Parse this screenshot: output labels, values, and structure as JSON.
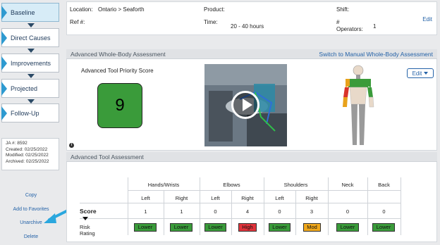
{
  "sidebar": {
    "steps": [
      {
        "label": "Baseline",
        "active": true
      },
      {
        "label": "Direct Causes",
        "active": false
      },
      {
        "label": "Improvements",
        "active": false
      },
      {
        "label": "Projected",
        "active": false
      },
      {
        "label": "Follow-Up",
        "active": false
      }
    ],
    "meta": {
      "ja": "JA #: 8592",
      "created": "Created: 02/25/2022",
      "modified": "Modified: 02/25/2022",
      "archived": "Archived: 02/25/2022"
    },
    "links": {
      "copy": "Copy",
      "favorites": "Add to Favorites",
      "unarchive": "Unarchive",
      "delete": "Delete"
    }
  },
  "info": {
    "location_label": "Location:",
    "location_value": "Ontario > Seaforth",
    "product_label": "Product:",
    "shift_label": "Shift:",
    "ref_label": "Ref #:",
    "time_label": "Time:",
    "time_value": "20 - 40 hours",
    "operators_label_1": "#",
    "operators_label_2": "Operators:",
    "operators_value": "1",
    "edit": "Edit"
  },
  "whole_body": {
    "title": "Advanced Whole-Body Assessment",
    "switch_link": "Switch to Manual Whole-Body Assessment",
    "score_title": "Advanced Tool Priority Score",
    "score": "9",
    "edit_button": "Edit",
    "colors": {
      "score": "#3a9b3a",
      "red": "#d9342b",
      "orange": "#e8a21b",
      "green": "#3a9b3a",
      "grey": "#9a9a9a"
    }
  },
  "tool_assessment": {
    "title": "Advanced Tool Assessment",
    "groups": [
      "Hands/Wrists",
      "Elbows",
      "Shoulders",
      "Neck",
      "Back"
    ],
    "sides": [
      "Left",
      "Right",
      "Left",
      "Right",
      "Left",
      "Right"
    ],
    "score_label": "Score",
    "risk_label": "Risk Rating",
    "scores": [
      "1",
      "1",
      "0",
      "4",
      "0",
      "3",
      "0",
      "0"
    ],
    "ratings": [
      {
        "text": "Lower",
        "color": "#3a9b3a"
      },
      {
        "text": "Lower",
        "color": "#3a9b3a"
      },
      {
        "text": "Lower",
        "color": "#3a9b3a"
      },
      {
        "text": "High",
        "color": "#e0333b"
      },
      {
        "text": "Lower",
        "color": "#3a9b3a"
      },
      {
        "text": "Mod",
        "color": "#f0a81c"
      },
      {
        "text": "Lower",
        "color": "#3a9b3a"
      },
      {
        "text": "Lower",
        "color": "#3a9b3a"
      }
    ]
  }
}
